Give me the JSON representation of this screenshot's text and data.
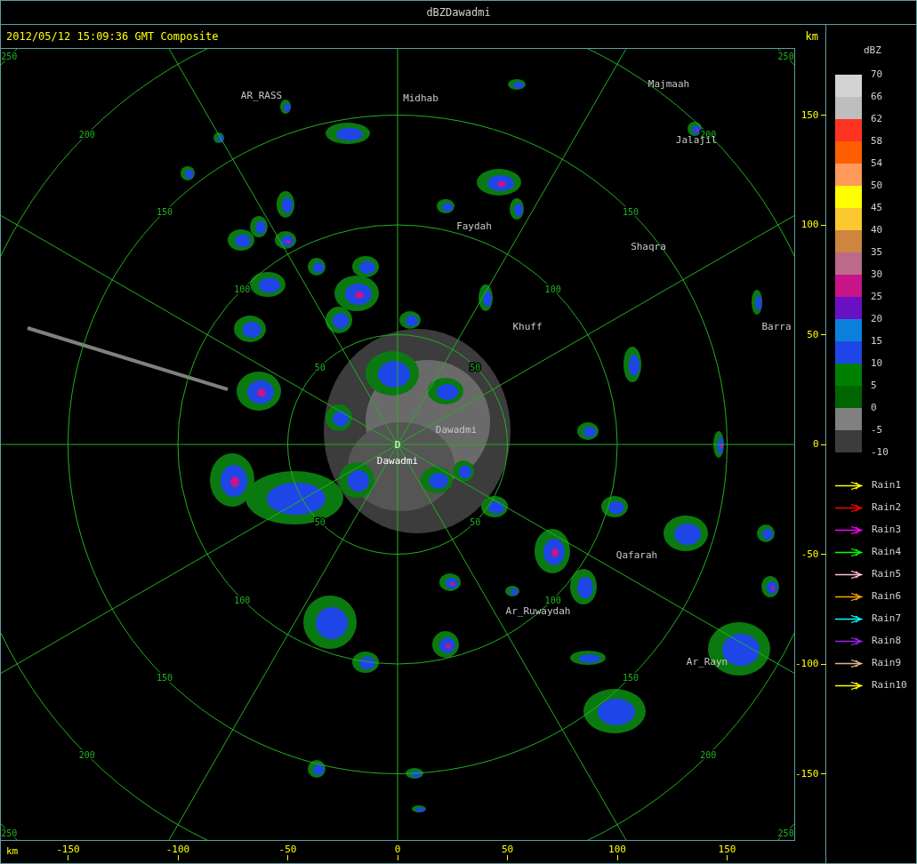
{
  "window": {
    "title": "dBZDawadmi"
  },
  "header": {
    "timestamp": "2012/05/12 15:09:36 GMT Composite"
  },
  "map": {
    "center_marker": "D",
    "range_rings": [
      {
        "labels": [
          "50",
          "50",
          "50",
          "50"
        ]
      },
      {
        "labels": [
          "100",
          "100",
          "100",
          "100"
        ]
      },
      {
        "labels": [
          "150",
          "150",
          "150",
          "150"
        ]
      },
      {
        "labels": [
          "200",
          "200",
          "200",
          "200"
        ]
      },
      {
        "labels": [
          "250",
          "250",
          "250",
          "250"
        ]
      }
    ],
    "places": [
      {
        "name": "AR_RASS",
        "kind": "town"
      },
      {
        "name": "Midhab",
        "kind": "town"
      },
      {
        "name": "Majmaah",
        "kind": "town"
      },
      {
        "name": "Jalajil",
        "kind": "town"
      },
      {
        "name": "Faydah",
        "kind": "town"
      },
      {
        "name": "Shaqra",
        "kind": "town"
      },
      {
        "name": "Khuff",
        "kind": "town"
      },
      {
        "name": "Barra",
        "kind": "town"
      },
      {
        "name": "Dawadmi",
        "kind": "town"
      },
      {
        "name": "Dawadmi",
        "kind": "site"
      },
      {
        "name": "Qafarah",
        "kind": "town"
      },
      {
        "name": "Ar_Ruwaydah",
        "kind": "town"
      },
      {
        "name": "Ar_Rayn",
        "kind": "town"
      }
    ]
  },
  "y_axis": {
    "unit": "km",
    "ticks": [
      "150",
      "100",
      "50",
      "0",
      "-50",
      "-100",
      "-150"
    ]
  },
  "x_axis": {
    "unit": "km",
    "ticks": [
      "-150",
      "-100",
      "-50",
      "0",
      "50",
      "100",
      "150"
    ]
  },
  "legend": {
    "title": "dBZ",
    "labels": [
      "70",
      "66",
      "62",
      "58",
      "54",
      "50",
      "45",
      "40",
      "35",
      "30",
      "25",
      "20",
      "15",
      "10",
      "5",
      "0",
      "-5",
      "-10"
    ],
    "bands": [
      {
        "color": "#d3d3d3"
      },
      {
        "color": "#bebebe"
      },
      {
        "color": "#ff3322"
      },
      {
        "color": "#ff5f00"
      },
      {
        "color": "#ff9a5a"
      },
      {
        "color": "#ffff00"
      },
      {
        "color": "#fbc832"
      },
      {
        "color": "#cd853f"
      },
      {
        "color": "#bc6a8a"
      },
      {
        "color": "#c81489"
      },
      {
        "color": "#6a10c4"
      },
      {
        "color": "#0a80dc"
      },
      {
        "color": "#1e46e6"
      },
      {
        "color": "#008000"
      },
      {
        "color": "#006400"
      },
      {
        "color": "#808080"
      },
      {
        "color": "#3c3c3c"
      }
    ],
    "arrows": [
      {
        "label": "Rain1",
        "color": "#ffff00"
      },
      {
        "label": "Rain2",
        "color": "#ff0000"
      },
      {
        "label": "Rain3",
        "color": "#ff00ff"
      },
      {
        "label": "Rain4",
        "color": "#00ff00"
      },
      {
        "label": "Rain5",
        "color": "#ffc0cb"
      },
      {
        "label": "Rain6",
        "color": "#ffa500"
      },
      {
        "label": "Rain7",
        "color": "#00ffff"
      },
      {
        "label": "Rain8",
        "color": "#a020f0"
      },
      {
        "label": "Rain9",
        "color": "#deb887"
      },
      {
        "label": "Rain10",
        "color": "#ffff00"
      }
    ]
  }
}
